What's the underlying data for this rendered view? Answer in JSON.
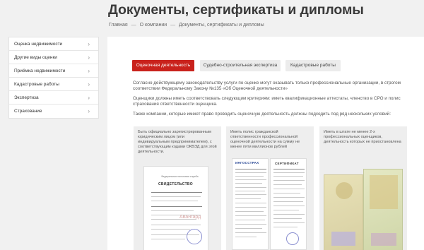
{
  "page": {
    "title": "Документы, сертификаты и дипломы"
  },
  "breadcrumb": {
    "home": "Главная",
    "sep": "—",
    "about": "О компании",
    "current": "Документы, сертификаты и дипломы"
  },
  "sidebar": {
    "items": [
      {
        "label": "Оценка недвижимости"
      },
      {
        "label": "Другие виды оценки"
      },
      {
        "label": "Приёмка недвижимости"
      },
      {
        "label": "Кадастровые работы"
      },
      {
        "label": "Экспертиза"
      },
      {
        "label": "Страхование"
      }
    ],
    "chevron": "›"
  },
  "tabs": [
    {
      "label": "Оценочная деятельность",
      "active": true
    },
    {
      "label": "Судебно-строительная экспертиза",
      "active": false
    },
    {
      "label": "Кадастровые работы",
      "active": false
    }
  ],
  "content": {
    "p1": "Согласно действующему законодательству услуги по оценке могут оказывать только профессиональные организации, в строгом соответствии Федеральному Закону №135 «Об Оценочной деятельности»",
    "p2": "Оценщики должны иметь соответствовать следующим критериям: иметь квалификационные аттестаты, членство в СРО и полис страхования ответственности оценщика.",
    "p3": "Также компании, которые имеют право проводить оценочную деятельность должны подходить под ряд нескольких условий:"
  },
  "cards": [
    {
      "text": "Быть официально зарегистрированным юридическим лицом (или индивидуальным предпринимателем), с соответствующим кодами ОКВЭД для этой деятельности.",
      "doc_title": "СВИДЕТЕЛЬСТВО",
      "doc_caption": "Федеральная налоговая служба"
    },
    {
      "text": "Иметь полис гражданской ответственности профессиональной оценочной деятельности на сумму не менее пяти миллионов рублей",
      "doc_brand": "ИНГОССТРАХ",
      "doc_title": "СЕРТИФИКАТ"
    },
    {
      "text": "Иметь в штате не менее 2-х профессиональных оценщиков, деятельность которых не приостановлена"
    }
  ],
  "watermark": "Авангард",
  "colors": {
    "accent": "#c9221c",
    "tab_inactive": "#ececec",
    "background": "#f1f1f1"
  }
}
